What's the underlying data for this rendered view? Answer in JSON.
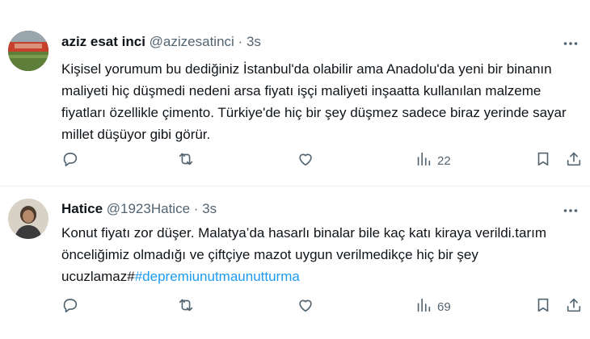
{
  "tweets": [
    {
      "name": "aziz esat inci",
      "handle": "@azizesatinci",
      "separator": "·",
      "time": "3s",
      "text": "Kişisel yorumum bu dediğiniz İstanbul'da olabilir ama Anadolu'da yeni bir binanın maliyeti hiç düşmedi nedeni arsa fiyatı işçi maliyeti inşaatta kullanılan malzeme fiyatları özellikle çimento. Türkiye'de hiç bir şey düşmez sadece biraz yerinde sayar millet düşüyor gibi görür.",
      "hashtag": "",
      "views": "22",
      "icons": [
        "reply-icon",
        "retweet-icon",
        "like-icon",
        "views-icon",
        "bookmark-icon",
        "share-icon",
        "more-icon"
      ]
    },
    {
      "name": "Hatice",
      "handle": "@1923Hatice",
      "separator": "·",
      "time": "3s",
      "text": "Konut fiyatı zor düşer. Malatya’da hasarlı binalar bile kaç katı kiraya verildi.tarım önceliğimiz olmadığı ve çiftçiye mazot uygun verilmedikçe hiç bir şey ucuzlamaz#",
      "hashtag": "#depremiunutmaunutturma",
      "views": "69",
      "icons": [
        "reply-icon",
        "retweet-icon",
        "like-icon",
        "views-icon",
        "bookmark-icon",
        "share-icon",
        "more-icon"
      ]
    }
  ],
  "colors": {
    "text": "#0f1419",
    "secondary": "#536471",
    "link": "#1d9bf0",
    "divider": "#eff3f4"
  }
}
